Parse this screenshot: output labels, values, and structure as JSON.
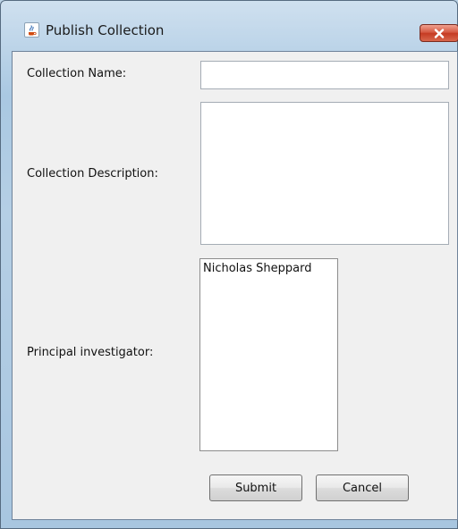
{
  "window": {
    "title": "Publish Collection",
    "icon": "java-coffee-cup-icon",
    "close_icon": "close-x-icon"
  },
  "form": {
    "collection_name": {
      "label": "Collection Name:",
      "value": ""
    },
    "collection_description": {
      "label": "Collection Description:",
      "value": ""
    },
    "principal_investigator": {
      "label": "Principal investigator:",
      "items": [
        "Nicholas Sheppard"
      ]
    }
  },
  "buttons": {
    "submit_label": "Submit",
    "cancel_label": "Cancel"
  },
  "colors": {
    "frame_blue": "#a9c8e2",
    "close_red": "#c63b23",
    "content_bg": "#f0f0f0"
  }
}
